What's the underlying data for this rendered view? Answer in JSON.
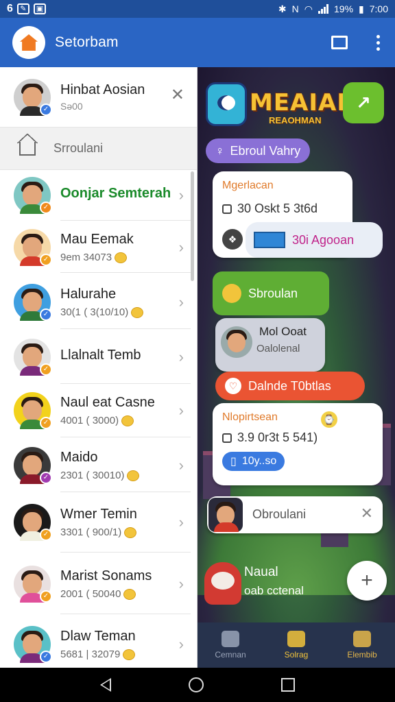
{
  "status_bar": {
    "battery": "19%",
    "time": "7:00",
    "left_icons": [
      "6",
      "edit",
      "image"
    ]
  },
  "app_bar": {
    "title": "Setorbam",
    "icons": [
      "window-icon",
      "more-vert-icon"
    ]
  },
  "drawer": {
    "profile": {
      "name": "Hinbat Aosian",
      "sub": "Sə00"
    },
    "home_label": "Srroulani",
    "contacts": [
      {
        "name": "Oonjar Semterah",
        "sub": "",
        "accent": "#1a8a2a",
        "bg": "#7fc7c3",
        "shirt": "#3a8a3a",
        "badge": "#f08a1c"
      },
      {
        "name": "Mau Eemak",
        "sub": "9em   34073",
        "accent": "#1f1f1f",
        "bg": "#f6d9a8",
        "shirt": "#d43a2a",
        "badge": "#f0a020"
      },
      {
        "name": "Halurahe",
        "sub": "30(1 ( 3(10/10)",
        "accent": "#1f1f1f",
        "bg": "#3f9fe0",
        "shirt": "#2f7a3a",
        "badge": "#3a7ae0"
      },
      {
        "name": "Llalnalt Temb",
        "sub": "",
        "accent": "#1f1f1f",
        "bg": "#e3e3e3",
        "shirt": "#7a2a7a",
        "badge": "#f0a020"
      },
      {
        "name": "Naul eat Casne",
        "sub": "4001 (  3000)",
        "accent": "#1f1f1f",
        "bg": "#f2d21c",
        "shirt": "#3a8a3a",
        "badge": "#f0a020"
      },
      {
        "name": "Maido",
        "sub": "2301 ( 30010)",
        "accent": "#1f1f1f",
        "bg": "#3a3a3a",
        "shirt": "#8a1a2a",
        "badge": "#a03ab0"
      },
      {
        "name": "Wmer Temin",
        "sub": "3301 ( 900/1)",
        "accent": "#1f1f1f",
        "bg": "#1a1a1a",
        "shirt": "#f0f0e0",
        "badge": "#f0a020"
      },
      {
        "name": "Marist Sonams",
        "sub": "2001 ( 50040",
        "accent": "#1f1f1f",
        "bg": "#e9e0e0",
        "shirt": "#e0509a",
        "badge": "#f0a020"
      },
      {
        "name": "Dlaw Teman",
        "sub": "5681 |  32079",
        "accent": "#1f1f1f",
        "bg": "#5ac0c7",
        "shirt": "#7a2a7a",
        "badge": "#3a7ae0"
      }
    ]
  },
  "game": {
    "logo_title": "MEAIAN",
    "logo_sub": "REAOHMAN",
    "pill_top": "Ebroul Vahry",
    "card1": {
      "title": "Mgerlacan",
      "line": "30 Oskt 5 3t6d"
    },
    "chip_agooan": "30i Agooan",
    "pill_green": "Sbroulan",
    "card_user": {
      "name": "Mol Ooat",
      "sub": "Oalolenal"
    },
    "pill_red": "Dalnde T0btlas",
    "card2": {
      "title": "Nlopirtsean",
      "line": "3.9 0r3t 5 541)",
      "chip": "10y..so"
    },
    "search_placeholder": "Obroulani",
    "bottom_note": {
      "title": "Naual",
      "sub": "oab cctenal"
    },
    "fab": "+"
  },
  "bottom_tabs": [
    {
      "label": "Cemnan",
      "color": "#9aa4b8",
      "icon": "chest-icon"
    },
    {
      "label": "Solrag",
      "color": "#f2c43b",
      "icon": "search-icon"
    },
    {
      "label": "Elembib",
      "color": "#e6b84a",
      "icon": "avatar-icon"
    }
  ]
}
